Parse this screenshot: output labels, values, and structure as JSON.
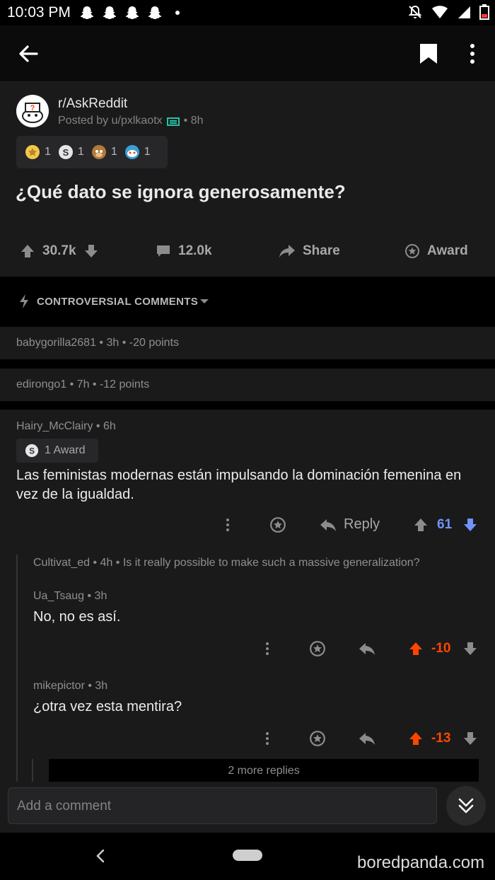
{
  "status": {
    "time": "10:03 PM"
  },
  "post": {
    "subreddit": "r/AskReddit",
    "posted_by": "Posted by u/pxlkaotx",
    "age": "• 8h",
    "awards": [
      "1",
      "1",
      "1",
      "1"
    ],
    "title": "¿Qué dato se ignora generosamente?",
    "votes": "30.7k",
    "comments": "12.0k",
    "share_label": "Share",
    "award_label": "Award"
  },
  "sort": {
    "label": "CONTROVERSIAL COMMENTS"
  },
  "collapsed_comments": [
    {
      "meta": "babygorilla2681 • 3h • -20 points"
    },
    {
      "meta": "edirongo1 • 7h • -12 points"
    }
  ],
  "comment": {
    "meta": "Hairy_McClairy • 6h",
    "award": "1 Award",
    "body": "Las feministas modernas están impulsando la dominación femenina en vez de la igualdad.",
    "reply_label": "Reply",
    "score": "61"
  },
  "collapsed_reply": {
    "meta": "Cultivat_ed • 4h • Is it really possible to make such a massive generalization?"
  },
  "replies": [
    {
      "meta": "Ua_Tsaug • 3h",
      "body": "No, no es así.",
      "score": "-10"
    },
    {
      "meta": "mikepictor • 3h",
      "body": "¿otra vez esta mentira?",
      "score": "-13"
    }
  ],
  "more_replies": "2 more replies",
  "composer": {
    "placeholder": "Add a comment"
  },
  "watermark": "boredpanda.com",
  "colors": {
    "upvote": "#ff4500",
    "downvote": "#7193ff",
    "background": "#1a1a1b"
  }
}
